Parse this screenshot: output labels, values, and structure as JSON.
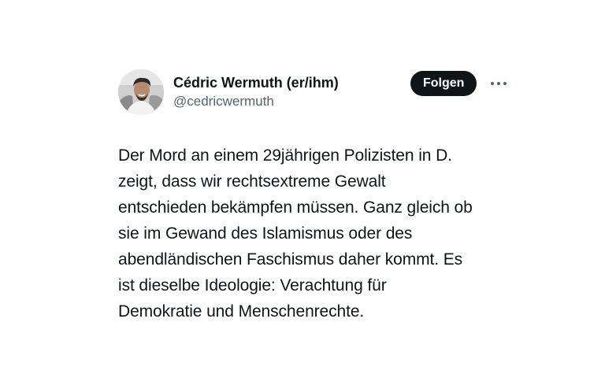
{
  "author": {
    "display_name": "Cédric Wermuth (er/ihm)",
    "handle": "@cedricwermuth",
    "avatar_icon": "person-photo-icon"
  },
  "actions": {
    "follow_label": "Folgen",
    "more_icon": "more-horizontal-icon"
  },
  "tweet": {
    "text": "Der Mord an einem 29jährigen Polizisten in D.\nzeigt, dass wir rechtsextreme Gewalt\nentschieden bekämpfen müssen. Ganz gleich ob\nsie im Gewand des Islamismus oder des\nabendländischen Faschismus daher kommt. Es\nist dieselbe Ideologie: Verachtung für\nDemokratie und Menschenrechte."
  },
  "colors": {
    "text_primary": "#0f1419",
    "text_secondary": "#536471",
    "button_bg": "#0f1419",
    "button_text": "#ffffff"
  }
}
